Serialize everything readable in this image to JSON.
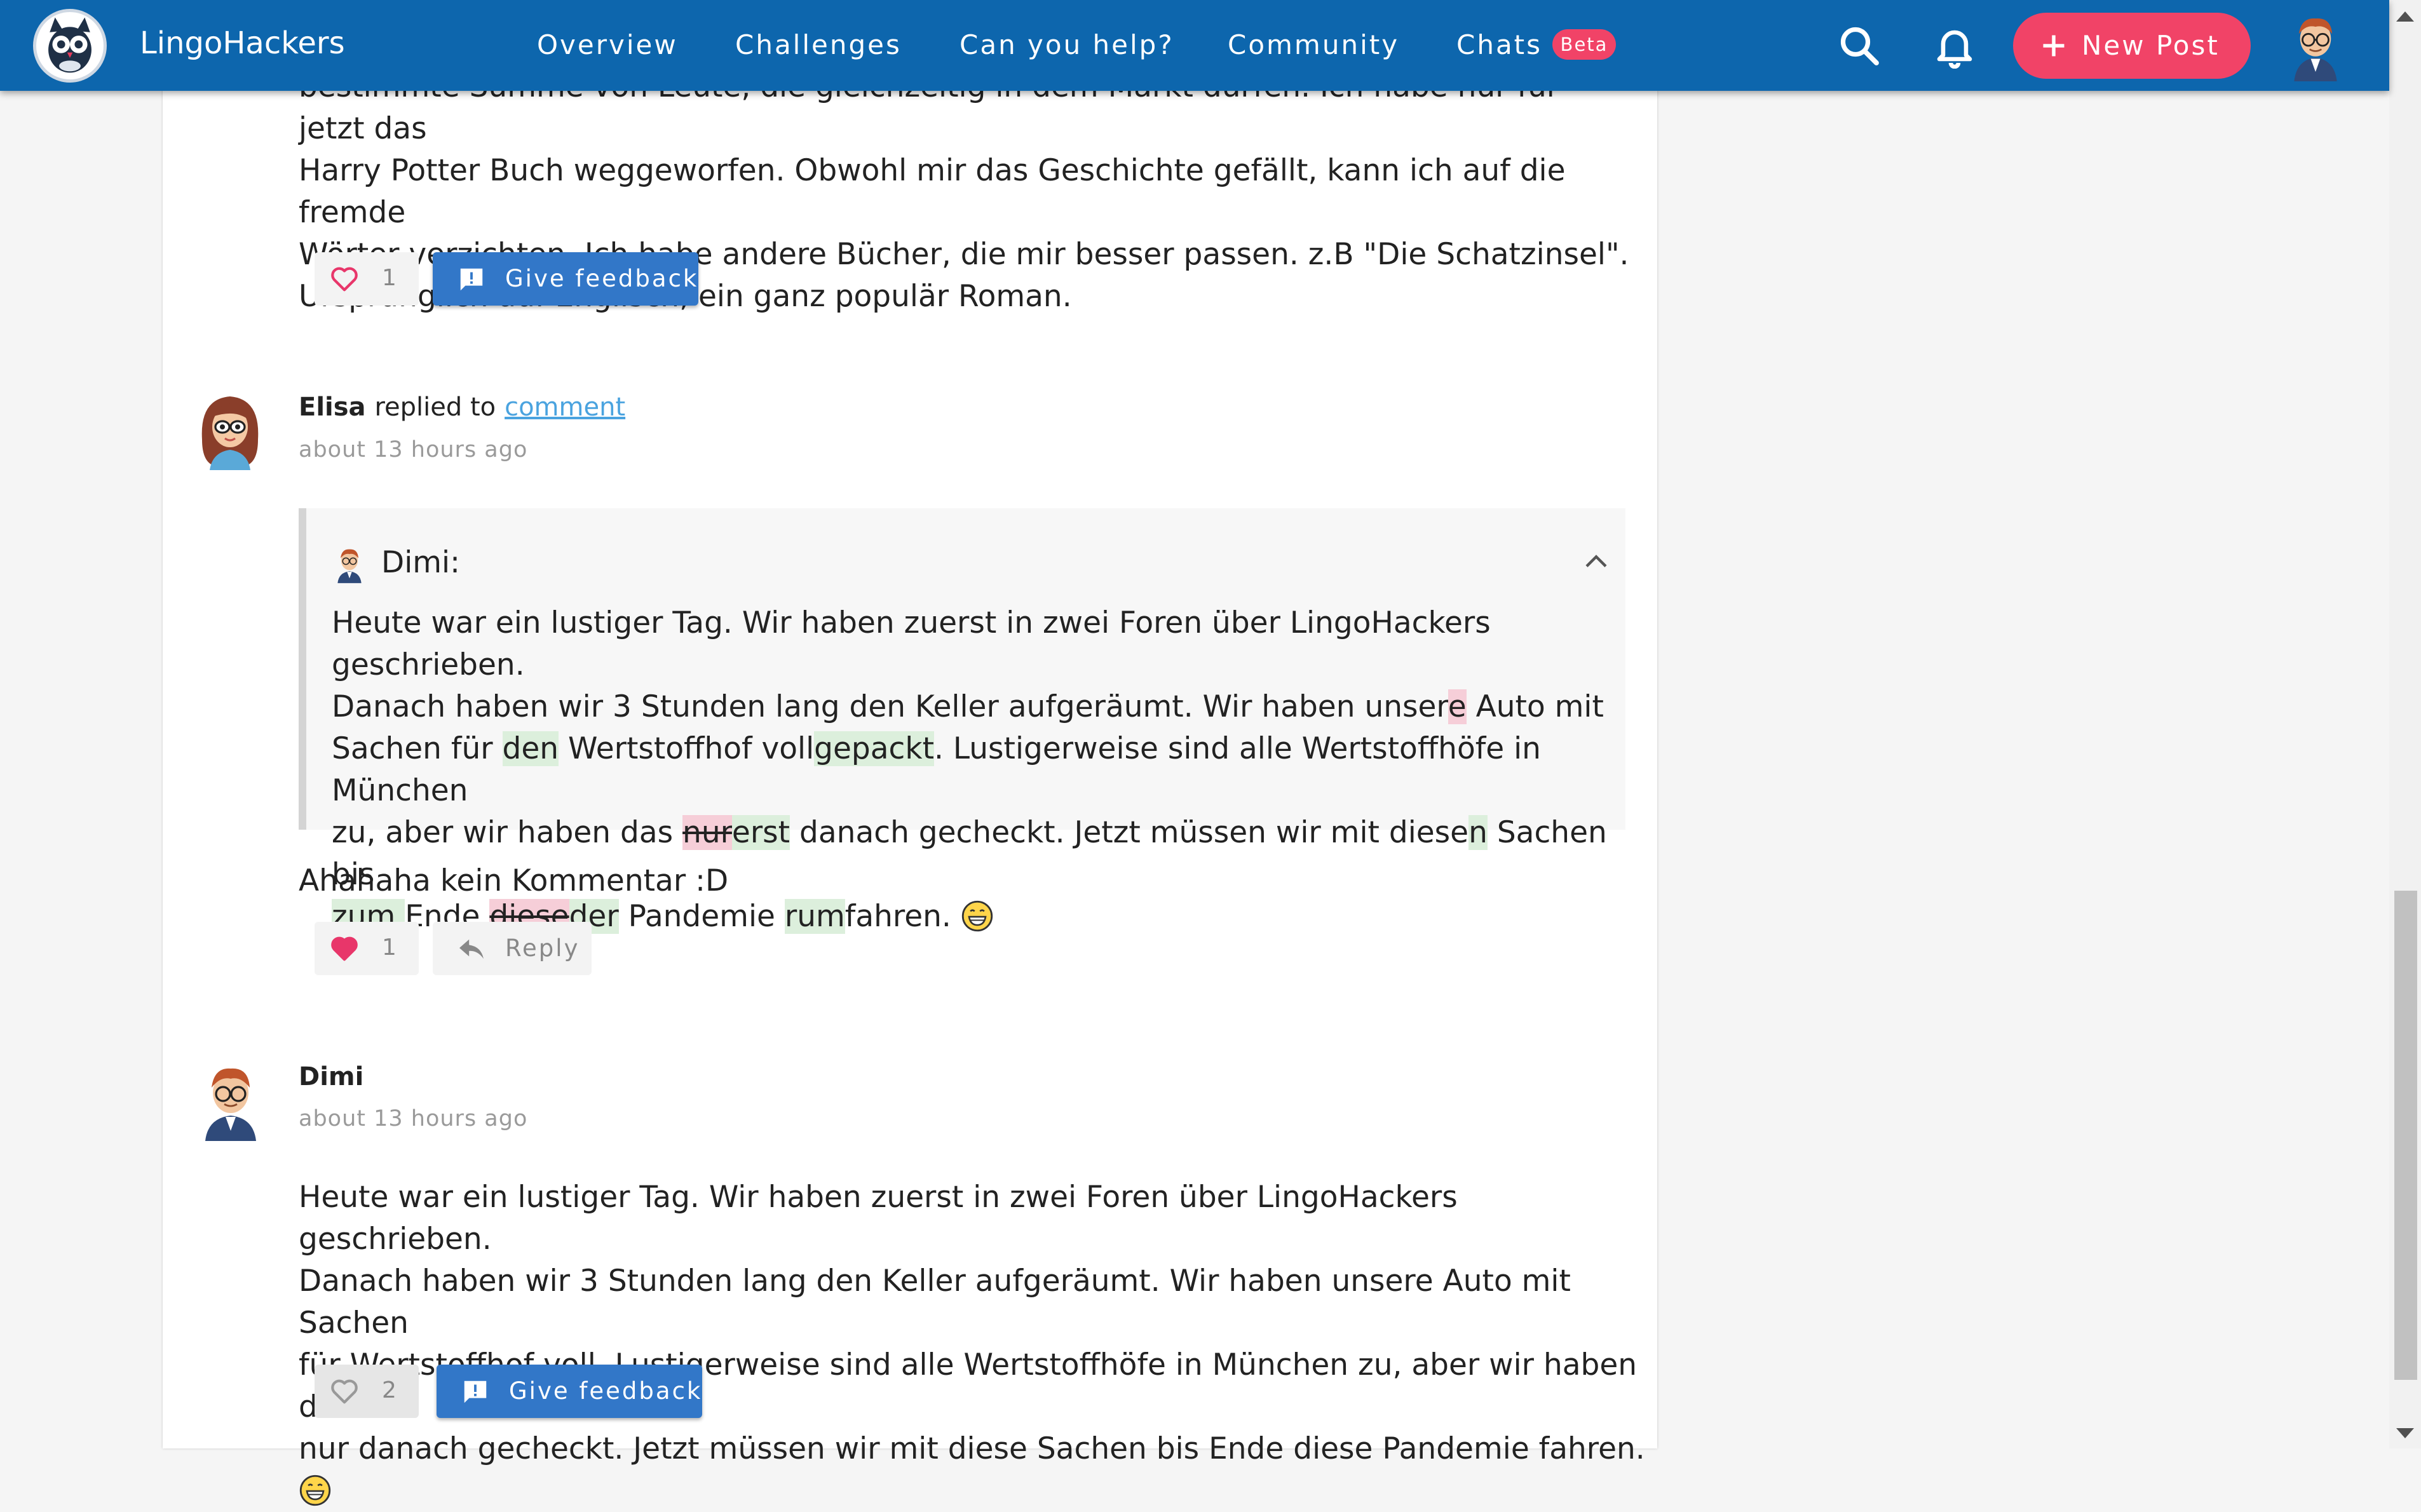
{
  "nav": {
    "brand": "LingoHackers",
    "links": [
      "Overview",
      "Challenges",
      "Can you help?",
      "Community",
      "Chats"
    ],
    "beta": "Beta",
    "new_post": "New Post",
    "icons": [
      "search-icon",
      "bell-icon",
      "plus-icon"
    ]
  },
  "post0": {
    "lines": [
      "bestimmte Summe von Leute, die gleichzeitig in dem Markt dürfen. Ich habe nur für jetzt das",
      "Harry Potter Buch weggeworfen. Obwohl mir das Geschichte gefällt, kann ich auf die fremde",
      "Wörter verzichten. Ich habe andere Bücher, die mir besser passen. z.B \"Die Schatzinsel\".",
      "Ursprünglich auf Englisch, ein ganz populär Roman."
    ],
    "likes": "1",
    "feedback_label": "Give feedback"
  },
  "reply": {
    "author": "Elisa",
    "action": "replied to",
    "link": "comment",
    "time": "about 13 hours ago",
    "quote": {
      "name": "Dimi:",
      "l1": "Heute war ein lustiger Tag. Wir haben zuerst in zwei Foren über LingoHackers geschrieben.",
      "l2a": "Danach haben wir 3 Stunden lang den Keller aufgeräumt. Wir haben unser",
      "l2b": "e",
      "l2c": " Auto mit",
      "l3a": "Sachen für ",
      "l3b": "den",
      "l3c": " Wertstoffhof voll",
      "l3d": "gepackt",
      "l3e": ". Lustigerweise sind alle Wertstoffhöfe in München",
      "l4a": "zu, aber wir haben das ",
      "l4b": "nur",
      "l4c": "erst",
      "l4d": " danach gecheckt. Jetzt müssen wir mit diese",
      "l4e": "n",
      "l4f": " Sachen bis",
      "l5a": "zum ",
      "l5b": "Ende ",
      "l5c": "diese",
      "l5d": "der",
      "l5e": " Pandemie ",
      "l5f": "rum",
      "l5g": "fahren. "
    },
    "text": "Ahahaha kein Kommentar :D",
    "likes": "1",
    "reply_label": "Reply"
  },
  "post2": {
    "author": "Dimi",
    "time": "about 13 hours ago",
    "lines": [
      "Heute war ein lustiger Tag. Wir haben zuerst in zwei Foren über LingoHackers geschrieben.",
      "Danach haben wir 3 Stunden lang den Keller aufgeräumt. Wir haben unsere Auto mit Sachen",
      "für Wertstoffhof voll. Lustigerweise sind alle Wertstoffhöfe in München zu, aber wir haben das",
      "nur danach gecheckt. Jetzt müssen wir mit diese Sachen bis Ende diese Pandemie fahren. "
    ],
    "likes": "2",
    "feedback_label": "Give feedback"
  },
  "colors": {
    "nav": "#0d66ad",
    "accent": "#f14367",
    "button": "#3277c8",
    "added": "#dcefdc",
    "removed": "#f6ced8",
    "link": "#4aa3df"
  }
}
